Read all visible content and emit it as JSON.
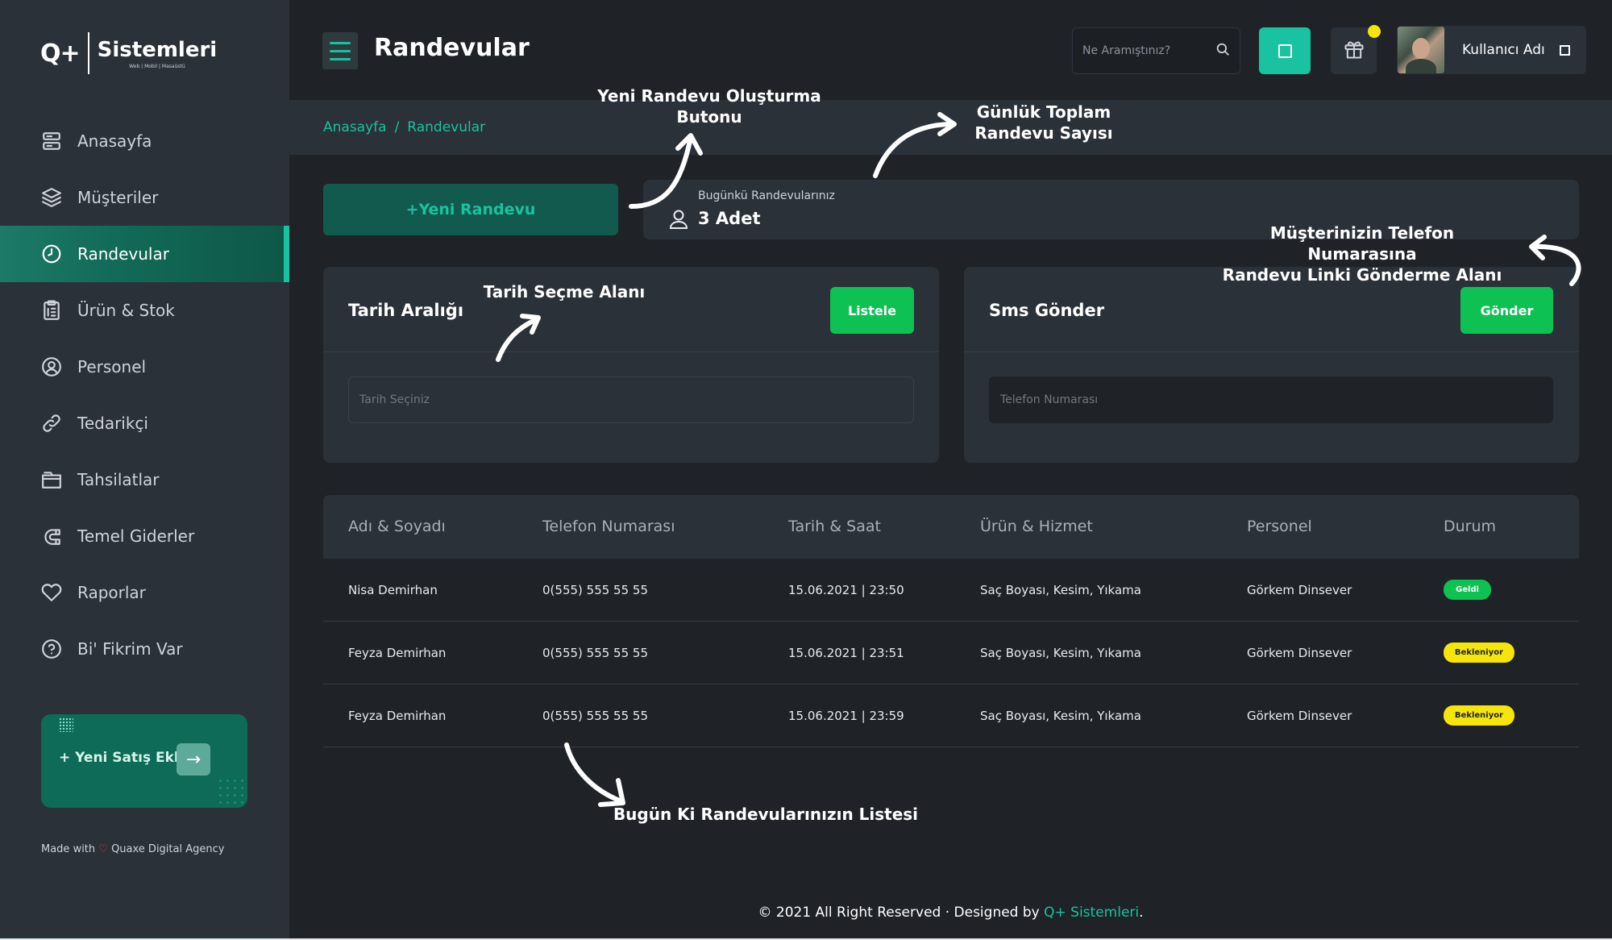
{
  "logo": {
    "mark": "Q+",
    "title": "Sistemleri",
    "subtitle": "Web | Mobil | Masaüstü"
  },
  "sidebar": {
    "items": [
      {
        "label": "Anasayfa",
        "icon": "dashboard-icon"
      },
      {
        "label": "Müşteriler",
        "icon": "layers-icon"
      },
      {
        "label": "Randevular",
        "icon": "clock-icon",
        "active": true
      },
      {
        "label": "Ürün & Stok",
        "icon": "clipboard-icon"
      },
      {
        "label": "Personel",
        "icon": "user-circle-icon"
      },
      {
        "label": "Tedarikçi",
        "icon": "link-icon"
      },
      {
        "label": "Tahsilatlar",
        "icon": "folder-icon"
      },
      {
        "label": "Temel Giderler",
        "icon": "magnet-icon"
      },
      {
        "label": "Raporlar",
        "icon": "heart-icon"
      },
      {
        "label": "Bi' Fikrim Var",
        "icon": "question-icon"
      }
    ],
    "sale_card_label": "+ Yeni Satış Ekle",
    "sale_card_arrow": "→",
    "made_with_prefix": "Made with ",
    "made_with_heart": "♡",
    "made_with_suffix": " Quaxe Digital Agency"
  },
  "header": {
    "title": "Randevular",
    "search_placeholder": "Ne Aramıştınız?",
    "user_name": "Kullanıcı Adı"
  },
  "breadcrumb": {
    "home": "Anasayfa",
    "separator": "/",
    "current": "Randevular"
  },
  "new_appointment_label": "+Yeni Randevu",
  "summary": {
    "label": "Bugünkü Randevularınız",
    "value": "3 Adet"
  },
  "date_card": {
    "title": "Tarih Aralığı",
    "button": "Listele",
    "placeholder": "Tarih Seçiniz"
  },
  "sms_card": {
    "title": "Sms Gönder",
    "button": "Gönder",
    "placeholder": "Telefon Numarası"
  },
  "table": {
    "headers": [
      "Adı & Soyadı",
      "Telefon Numarası",
      "Tarih & Saat",
      "Ürün & Hizmet",
      "Personel",
      "Durum"
    ],
    "rows": [
      {
        "name": "Nisa Demirhan",
        "phone": "0(555) 555 55 55",
        "datetime": "15.06.2021 | 23:50",
        "service": "Saç Boyası, Kesim, Yıkama",
        "staff": "Görkem Dinsever",
        "status": "Geldi",
        "status_type": "geldi"
      },
      {
        "name": "Feyza Demirhan",
        "phone": "0(555) 555 55 55",
        "datetime": "15.06.2021 | 23:51",
        "service": "Saç Boyası, Kesim, Yıkama",
        "staff": "Görkem Dinsever",
        "status": "Bekleniyor",
        "status_type": "bekle"
      },
      {
        "name": "Feyza Demirhan",
        "phone": "0(555) 555 55 55",
        "datetime": "15.06.2021 | 23:59",
        "service": "Saç Boyası, Kesim, Yıkama",
        "staff": "Görkem Dinsever",
        "status": "Bekleniyor",
        "status_type": "bekle"
      }
    ]
  },
  "annotations": {
    "new_button": "Yeni Randevu Oluşturma\nButonu",
    "daily_total": "Günlük Toplam\nRandevu Sayısı",
    "sms_area": "Müşterinizin Telefon Numarasına\nRandevu Linki Gönderme Alanı",
    "date_area": "Tarih Seçme Alanı",
    "list": "Bugün Ki Randevularınızın Listesi"
  },
  "footer": {
    "text": "© 2021 All Right Reserved · Designed by ",
    "brand": "Q+ Sistemleri",
    "end": "."
  },
  "colors": {
    "accent": "#19c2a0",
    "success": "#0dc152",
    "warning": "#f5e50a",
    "panel": "#2b3139",
    "background": "#1f2328"
  }
}
